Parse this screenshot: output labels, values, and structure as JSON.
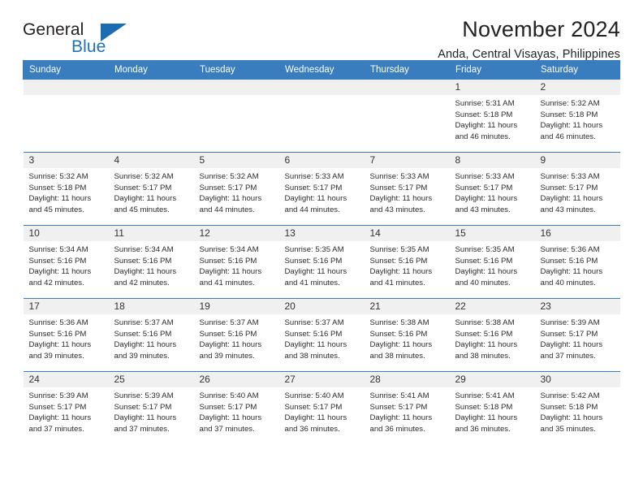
{
  "brand": {
    "name_part1": "General",
    "name_part2": "Blue",
    "logo_icon": "triangle-logo-icon"
  },
  "header": {
    "month_title": "November 2024",
    "location": "Anda, Central Visayas, Philippines"
  },
  "colors": {
    "header_blue": "#3a7dbe",
    "brand_blue": "#1d71b8",
    "daynum_bg": "#f0f0f0"
  },
  "weekday_headers": [
    "Sunday",
    "Monday",
    "Tuesday",
    "Wednesday",
    "Thursday",
    "Friday",
    "Saturday"
  ],
  "labels": {
    "sunrise_prefix": "Sunrise:",
    "sunset_prefix": "Sunset:",
    "daylight_prefix": "Daylight:"
  },
  "weeks": [
    [
      {
        "day": "",
        "sunrise": "",
        "sunset": "",
        "daylight": "",
        "empty": true
      },
      {
        "day": "",
        "sunrise": "",
        "sunset": "",
        "daylight": "",
        "empty": true
      },
      {
        "day": "",
        "sunrise": "",
        "sunset": "",
        "daylight": "",
        "empty": true
      },
      {
        "day": "",
        "sunrise": "",
        "sunset": "",
        "daylight": "",
        "empty": true
      },
      {
        "day": "",
        "sunrise": "",
        "sunset": "",
        "daylight": "",
        "empty": true
      },
      {
        "day": "1",
        "sunrise": "Sunrise: 5:31 AM",
        "sunset": "Sunset: 5:18 PM",
        "daylight": "Daylight: 11 hours and 46 minutes.",
        "empty": false
      },
      {
        "day": "2",
        "sunrise": "Sunrise: 5:32 AM",
        "sunset": "Sunset: 5:18 PM",
        "daylight": "Daylight: 11 hours and 46 minutes.",
        "empty": false
      }
    ],
    [
      {
        "day": "3",
        "sunrise": "Sunrise: 5:32 AM",
        "sunset": "Sunset: 5:18 PM",
        "daylight": "Daylight: 11 hours and 45 minutes.",
        "empty": false
      },
      {
        "day": "4",
        "sunrise": "Sunrise: 5:32 AM",
        "sunset": "Sunset: 5:17 PM",
        "daylight": "Daylight: 11 hours and 45 minutes.",
        "empty": false
      },
      {
        "day": "5",
        "sunrise": "Sunrise: 5:32 AM",
        "sunset": "Sunset: 5:17 PM",
        "daylight": "Daylight: 11 hours and 44 minutes.",
        "empty": false
      },
      {
        "day": "6",
        "sunrise": "Sunrise: 5:33 AM",
        "sunset": "Sunset: 5:17 PM",
        "daylight": "Daylight: 11 hours and 44 minutes.",
        "empty": false
      },
      {
        "day": "7",
        "sunrise": "Sunrise: 5:33 AM",
        "sunset": "Sunset: 5:17 PM",
        "daylight": "Daylight: 11 hours and 43 minutes.",
        "empty": false
      },
      {
        "day": "8",
        "sunrise": "Sunrise: 5:33 AM",
        "sunset": "Sunset: 5:17 PM",
        "daylight": "Daylight: 11 hours and 43 minutes.",
        "empty": false
      },
      {
        "day": "9",
        "sunrise": "Sunrise: 5:33 AM",
        "sunset": "Sunset: 5:17 PM",
        "daylight": "Daylight: 11 hours and 43 minutes.",
        "empty": false
      }
    ],
    [
      {
        "day": "10",
        "sunrise": "Sunrise: 5:34 AM",
        "sunset": "Sunset: 5:16 PM",
        "daylight": "Daylight: 11 hours and 42 minutes.",
        "empty": false
      },
      {
        "day": "11",
        "sunrise": "Sunrise: 5:34 AM",
        "sunset": "Sunset: 5:16 PM",
        "daylight": "Daylight: 11 hours and 42 minutes.",
        "empty": false
      },
      {
        "day": "12",
        "sunrise": "Sunrise: 5:34 AM",
        "sunset": "Sunset: 5:16 PM",
        "daylight": "Daylight: 11 hours and 41 minutes.",
        "empty": false
      },
      {
        "day": "13",
        "sunrise": "Sunrise: 5:35 AM",
        "sunset": "Sunset: 5:16 PM",
        "daylight": "Daylight: 11 hours and 41 minutes.",
        "empty": false
      },
      {
        "day": "14",
        "sunrise": "Sunrise: 5:35 AM",
        "sunset": "Sunset: 5:16 PM",
        "daylight": "Daylight: 11 hours and 41 minutes.",
        "empty": false
      },
      {
        "day": "15",
        "sunrise": "Sunrise: 5:35 AM",
        "sunset": "Sunset: 5:16 PM",
        "daylight": "Daylight: 11 hours and 40 minutes.",
        "empty": false
      },
      {
        "day": "16",
        "sunrise": "Sunrise: 5:36 AM",
        "sunset": "Sunset: 5:16 PM",
        "daylight": "Daylight: 11 hours and 40 minutes.",
        "empty": false
      }
    ],
    [
      {
        "day": "17",
        "sunrise": "Sunrise: 5:36 AM",
        "sunset": "Sunset: 5:16 PM",
        "daylight": "Daylight: 11 hours and 39 minutes.",
        "empty": false
      },
      {
        "day": "18",
        "sunrise": "Sunrise: 5:37 AM",
        "sunset": "Sunset: 5:16 PM",
        "daylight": "Daylight: 11 hours and 39 minutes.",
        "empty": false
      },
      {
        "day": "19",
        "sunrise": "Sunrise: 5:37 AM",
        "sunset": "Sunset: 5:16 PM",
        "daylight": "Daylight: 11 hours and 39 minutes.",
        "empty": false
      },
      {
        "day": "20",
        "sunrise": "Sunrise: 5:37 AM",
        "sunset": "Sunset: 5:16 PM",
        "daylight": "Daylight: 11 hours and 38 minutes.",
        "empty": false
      },
      {
        "day": "21",
        "sunrise": "Sunrise: 5:38 AM",
        "sunset": "Sunset: 5:16 PM",
        "daylight": "Daylight: 11 hours and 38 minutes.",
        "empty": false
      },
      {
        "day": "22",
        "sunrise": "Sunrise: 5:38 AM",
        "sunset": "Sunset: 5:16 PM",
        "daylight": "Daylight: 11 hours and 38 minutes.",
        "empty": false
      },
      {
        "day": "23",
        "sunrise": "Sunrise: 5:39 AM",
        "sunset": "Sunset: 5:17 PM",
        "daylight": "Daylight: 11 hours and 37 minutes.",
        "empty": false
      }
    ],
    [
      {
        "day": "24",
        "sunrise": "Sunrise: 5:39 AM",
        "sunset": "Sunset: 5:17 PM",
        "daylight": "Daylight: 11 hours and 37 minutes.",
        "empty": false
      },
      {
        "day": "25",
        "sunrise": "Sunrise: 5:39 AM",
        "sunset": "Sunset: 5:17 PM",
        "daylight": "Daylight: 11 hours and 37 minutes.",
        "empty": false
      },
      {
        "day": "26",
        "sunrise": "Sunrise: 5:40 AM",
        "sunset": "Sunset: 5:17 PM",
        "daylight": "Daylight: 11 hours and 37 minutes.",
        "empty": false
      },
      {
        "day": "27",
        "sunrise": "Sunrise: 5:40 AM",
        "sunset": "Sunset: 5:17 PM",
        "daylight": "Daylight: 11 hours and 36 minutes.",
        "empty": false
      },
      {
        "day": "28",
        "sunrise": "Sunrise: 5:41 AM",
        "sunset": "Sunset: 5:17 PM",
        "daylight": "Daylight: 11 hours and 36 minutes.",
        "empty": false
      },
      {
        "day": "29",
        "sunrise": "Sunrise: 5:41 AM",
        "sunset": "Sunset: 5:18 PM",
        "daylight": "Daylight: 11 hours and 36 minutes.",
        "empty": false
      },
      {
        "day": "30",
        "sunrise": "Sunrise: 5:42 AM",
        "sunset": "Sunset: 5:18 PM",
        "daylight": "Daylight: 11 hours and 35 minutes.",
        "empty": false
      }
    ]
  ]
}
